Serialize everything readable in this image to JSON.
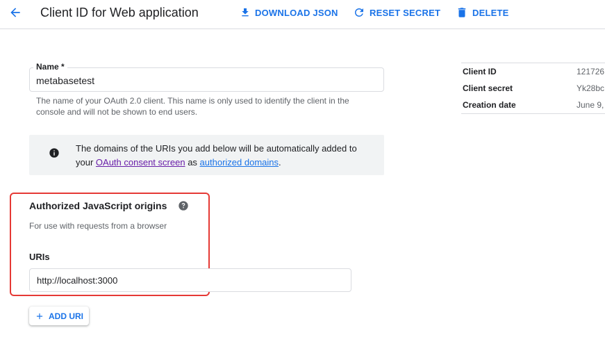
{
  "header": {
    "title": "Client ID for Web application",
    "download_json": "DOWNLOAD JSON",
    "reset_secret": "RESET SECRET",
    "delete": "DELETE"
  },
  "name_field": {
    "label": "Name *",
    "value": "metabasetest",
    "helper": "The name of your OAuth 2.0 client. This name is only used to identify the client in the console and will not be shown to end users."
  },
  "info_box": {
    "text_before": "The domains of the URIs you add below will be automatically added to your",
    "consent_link": "OAuth consent screen",
    "text_between": "as",
    "domains_link": "authorized domains",
    "text_after": "."
  },
  "js_origins": {
    "title": "Authorized JavaScript origins",
    "subtitle": "For use with requests from a browser",
    "uris_label": "URIs",
    "uri_value": "http://localhost:3000",
    "add_uri": "ADD URI"
  },
  "client_details": [
    {
      "key": "Client ID",
      "value": "121726"
    },
    {
      "key": "Client secret",
      "value": "Yk28bc"
    },
    {
      "key": "Creation date",
      "value": "June 9,"
    }
  ],
  "colors": {
    "accent": "#1a73e8",
    "highlight": "#e53935",
    "visited_link": "#681da8"
  },
  "icons": [
    "arrow-back-icon",
    "download-icon",
    "refresh-icon",
    "trash-icon",
    "info-icon",
    "help-icon",
    "plus-icon"
  ]
}
